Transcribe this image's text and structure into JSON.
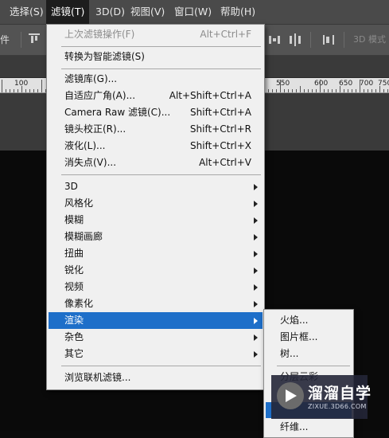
{
  "menubar": {
    "items": [
      "选择(S)",
      "滤镜(T)",
      "3D(D)",
      "视图(V)",
      "窗口(W)",
      "帮助(H)"
    ],
    "active_index": 1
  },
  "options_bar": {
    "left_label": "件",
    "mode_label": "3D 模式"
  },
  "ruler": {
    "labels": [
      "100",
      "550",
      "600",
      "650",
      "700",
      "750"
    ]
  },
  "filter_menu": {
    "last_filter": {
      "label": "上次滤镜操作(F)",
      "shortcut": "Alt+Ctrl+F",
      "disabled": true
    },
    "smart": {
      "label": "转换为智能滤镜(S)"
    },
    "group2": [
      {
        "label": "滤镜库(G)...",
        "shortcut": ""
      },
      {
        "label": "自适应广角(A)...",
        "shortcut": "Alt+Shift+Ctrl+A"
      },
      {
        "label": "Camera Raw 滤镜(C)...",
        "shortcut": "Shift+Ctrl+A"
      },
      {
        "label": "镜头校正(R)...",
        "shortcut": "Shift+Ctrl+R"
      },
      {
        "label": "液化(L)...",
        "shortcut": "Shift+Ctrl+X"
      },
      {
        "label": "消失点(V)...",
        "shortcut": "Alt+Ctrl+V"
      }
    ],
    "submenus": [
      {
        "label": "3D"
      },
      {
        "label": "风格化"
      },
      {
        "label": "模糊"
      },
      {
        "label": "模糊画廊"
      },
      {
        "label": "扭曲"
      },
      {
        "label": "锐化"
      },
      {
        "label": "视频"
      },
      {
        "label": "像素化"
      },
      {
        "label": "渲染"
      },
      {
        "label": "杂色"
      },
      {
        "label": "其它"
      }
    ],
    "highlighted": "渲染",
    "browse": {
      "label": "浏览联机滤镜..."
    }
  },
  "render_submenu": {
    "items": [
      "火焰...",
      "图片框...",
      "树...",
      "分层云彩",
      "",
      "纤维..."
    ]
  },
  "watermark": {
    "title": "溜溜自学",
    "url": "ZIXUE.3D66.COM"
  },
  "colors": {
    "menu_highlight": "#1e6fc9",
    "menubar_bg": "#4a4a4a",
    "menu_bg": "#f0f0f0"
  }
}
